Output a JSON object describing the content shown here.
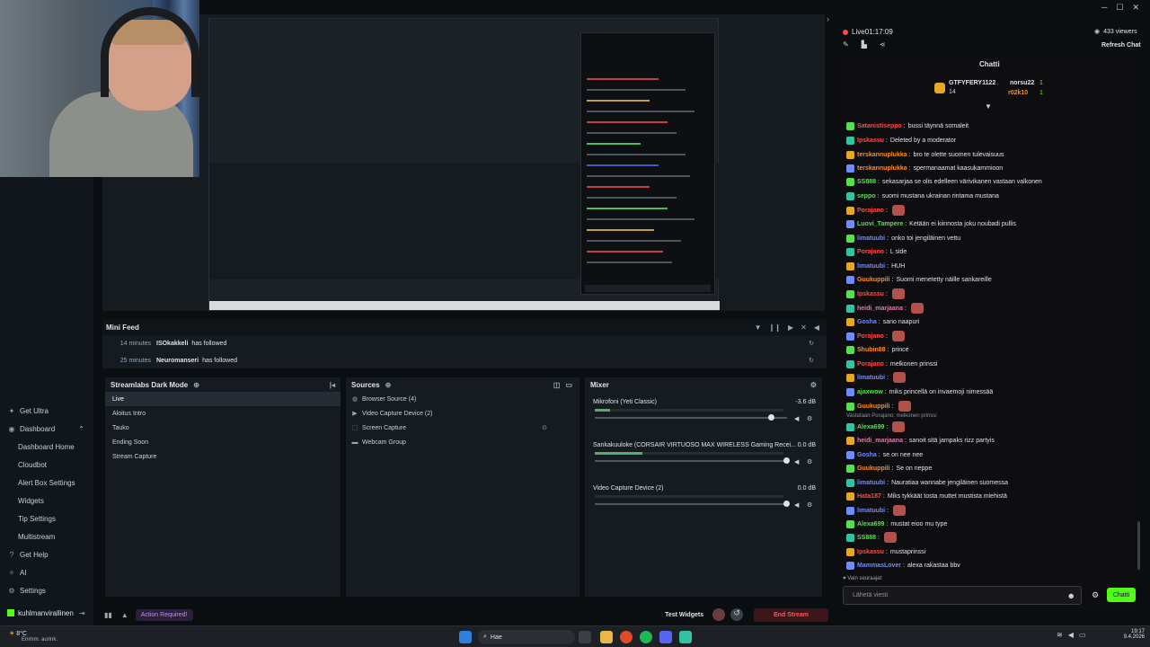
{
  "stream": {
    "status": "Live",
    "time": "01:17:09",
    "viewers": "433 viewers",
    "refresh_label": "Refresh Chat"
  },
  "sidebar": {
    "get_ultra": "Get Ultra",
    "dashboard": "Dashboard",
    "items": [
      "Dashboard Home",
      "Cloudbot",
      "Alert Box Settings",
      "Widgets",
      "Tip Settings",
      "Multistream"
    ],
    "get_help": "Get Help",
    "ai": "AI",
    "settings": "Settings",
    "username": "kuhlmanvirallinen"
  },
  "mini_feed": {
    "title": "Mini Feed",
    "rows": [
      {
        "time": "14 minutes",
        "user": "ISOkakkeli",
        "action": "has followed"
      },
      {
        "time": "25 minutes",
        "user": "Neuromanseri",
        "action": "has followed"
      }
    ]
  },
  "scenes": {
    "title": "Streamlabs Dark Mode",
    "items": [
      "Live",
      "Aloitus Intro",
      "Tauko",
      "Ending Soon",
      "Stream Capture"
    ]
  },
  "sources": {
    "title": "Sources",
    "items": [
      "Browser Source (4)",
      "Video Capture Device (2)",
      "Screen Capture",
      "Webcam Group"
    ]
  },
  "mixer": {
    "title": "Mixer",
    "items": [
      {
        "name": "Mikrofoni (Yeti Classic)",
        "db": "-3.6 dB",
        "level": 0.08,
        "volume": 0.92
      },
      {
        "name": "Sankakuuloke (CORSAIR VIRTUOSO MAX WIRELESS Gaming Recei...",
        "db": "0.0 dB",
        "level": 0.25,
        "volume": 1.0
      },
      {
        "name": "Video Capture Device (2)",
        "db": "0.0 dB",
        "level": 0,
        "volume": 1.0
      }
    ]
  },
  "footer": {
    "action_required": "Action Required!",
    "test_widgets": "Test Widgets",
    "end_stream": "End Stream"
  },
  "chat": {
    "title": "Chatti",
    "top_user": {
      "name": "GTFYFERY1122",
      "count": "14"
    },
    "leaders": [
      {
        "name": "norsu22",
        "count": "1"
      },
      {
        "name": "r02k10",
        "count": "1"
      }
    ],
    "messages": [
      {
        "user": "Satanistiseppo",
        "text": "bussi täynnä somaleit",
        "color": "#ff4a4a"
      },
      {
        "user": "Ipskassu",
        "text": "Deleted by a moderator",
        "color": "#ff4a4a"
      },
      {
        "user": "terskannuplukka",
        "text": "bro te olette suomen tulevaisuus",
        "color": "#ff8c1a"
      },
      {
        "user": "terskannuplukka",
        "text": "spermanaamat kaasukammioon",
        "color": "#ff8c1a"
      },
      {
        "user": "SS888",
        "text": "sekasarjaa se olis edelleen värivikanen vastaan valkonen",
        "color": "#56e04e"
      },
      {
        "user": "seppo",
        "text": "suomi mustana ukrainan rintama mustana",
        "color": "#56e04e"
      },
      {
        "user": "Porajano",
        "text": "",
        "color": "#ff4a4a"
      },
      {
        "user": "Luovi_Tampere",
        "text": "Ketään ei kiinnosta joku noubadi pullis",
        "color": "#56e04e"
      },
      {
        "user": "limatuubi",
        "text": "onko toi jengiläinen vettu",
        "color": "#6f8cff"
      },
      {
        "user": "Porajano",
        "text": "L side",
        "color": "#ff4a4a"
      },
      {
        "user": "limatuubi",
        "text": "HUH",
        "color": "#6f8cff"
      },
      {
        "user": "Guukuppili",
        "text": "Suomi menetetty näille sankareille",
        "color": "#ff8c1a"
      },
      {
        "user": "Ipskassu",
        "text": "",
        "color": "#ff4a4a"
      },
      {
        "user": "heidi_marjaana",
        "text": "",
        "color": "#ff69b4"
      },
      {
        "user": "Gosha",
        "text": "sano naapuri",
        "color": "#6f8cff"
      },
      {
        "user": "Porajano",
        "text": "",
        "color": "#ff4a4a"
      },
      {
        "user": "Shubin88",
        "text": "prince",
        "color": "#ff8c1a"
      },
      {
        "user": "Porajano",
        "text": "melkonen prinssi",
        "color": "#ff4a4a"
      },
      {
        "user": "limatuubi",
        "text": "",
        "color": "#6f8cff"
      },
      {
        "user": "ajaxwow",
        "text": "miks princellä on invaemoji nimessää",
        "color": "#56e04e"
      },
      {
        "user": "Guukuppili",
        "text": "",
        "color": "#ff8c1a"
      },
      {
        "user": "Alexa699",
        "text": "",
        "color": "#56e04e"
      },
      {
        "user": "heidi_marjaana",
        "text": "sanoit sitä jampaks rizz partyis",
        "color": "#ff69b4"
      },
      {
        "user": "Gosha",
        "text": "se on nee nee",
        "color": "#6f8cff"
      },
      {
        "user": "Guukuppili",
        "text": "Se on neppe",
        "color": "#ff8c1a"
      },
      {
        "user": "limatuubi",
        "text": "Nauratiaa wannabe jengiläinen suomessa",
        "color": "#6f8cff"
      },
      {
        "user": "Hata187",
        "text": "Miks tykkäät tosta muttet mustista miehistä",
        "color": "#ff4a4a"
      },
      {
        "user": "limatuubi",
        "text": "",
        "color": "#6f8cff"
      },
      {
        "user": "Alexa699",
        "text": "mustat eioo mu type",
        "color": "#56e04e"
      },
      {
        "user": "SS888",
        "text": "",
        "color": "#56e04e"
      },
      {
        "user": "Ipskassu",
        "text": "mustaprinssi",
        "color": "#ff4a4a"
      },
      {
        "user": "MammasLover",
        "text": "alexa rakastaa bbv",
        "color": "#6f8cff"
      }
    ],
    "reply_note": "Vastataan Porajano: melkonen prinssi",
    "followers_only": "Vain seuraajat",
    "input_placeholder": "Lähetä viesti",
    "send_label": "Chatti"
  },
  "taskbar": {
    "weather_temp": "8°C",
    "weather_desc": "Enimm. aurink.",
    "search_label": "Hae",
    "time": "19:17",
    "date": "9.4.2026"
  },
  "colors": {
    "accent": "#31c3a2",
    "live": "#ff4a4a",
    "send": "#53fc18",
    "end_stream": "#ff5555"
  }
}
